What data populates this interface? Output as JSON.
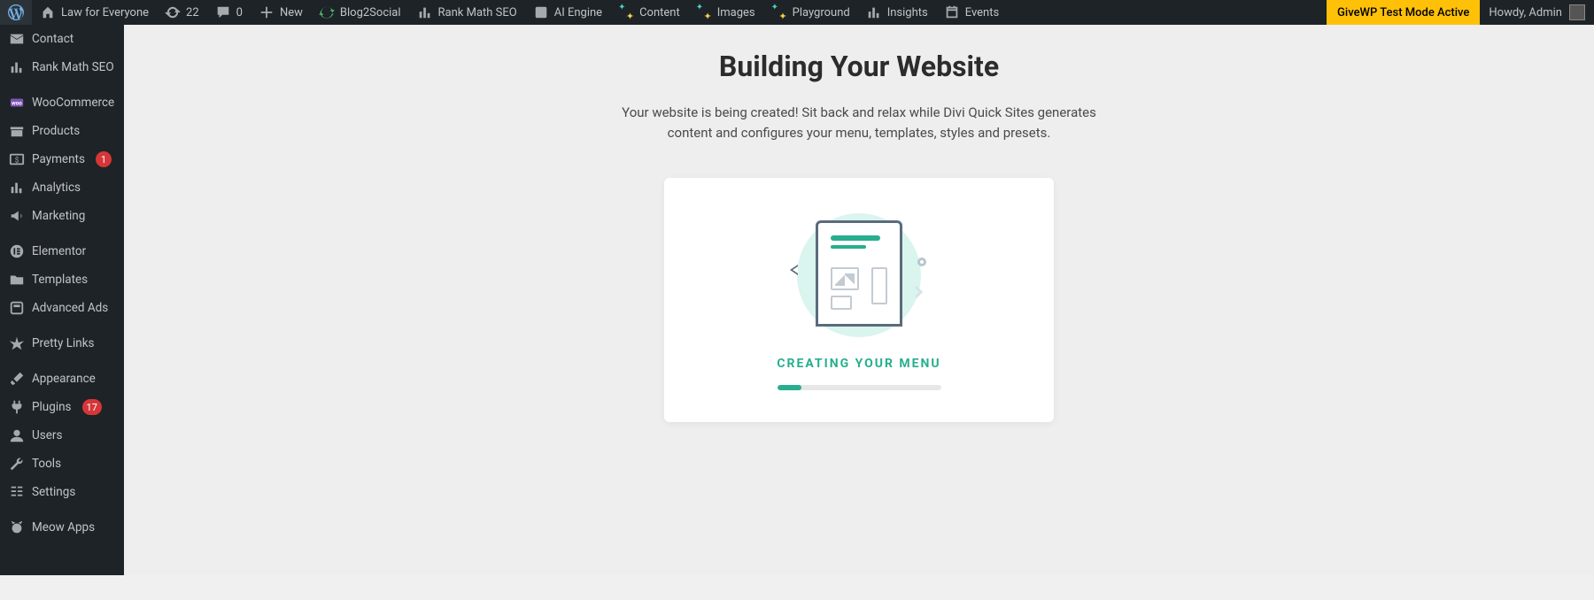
{
  "adminbar": {
    "site_name": "Law for Everyone",
    "updates": "22",
    "comments": "0",
    "new_label": "New",
    "items": [
      "Blog2Social",
      "Rank Math SEO",
      "AI Engine",
      "Content",
      "Images",
      "Playground",
      "Insights",
      "Events"
    ],
    "givewp_notice": "GiveWP Test Mode Active",
    "howdy": "Howdy, Admin"
  },
  "sidebar": {
    "items": [
      {
        "label": "Contact",
        "icon": "mail-icon",
        "badge": null
      },
      {
        "label": "Rank Math SEO",
        "icon": "chart-icon",
        "badge": null
      },
      {
        "spacer": true
      },
      {
        "label": "WooCommerce",
        "icon": "woo-icon",
        "badge": null
      },
      {
        "label": "Products",
        "icon": "archive-icon",
        "badge": null
      },
      {
        "label": "Payments",
        "icon": "payments-icon",
        "badge": "1"
      },
      {
        "label": "Analytics",
        "icon": "analytics-icon",
        "badge": null
      },
      {
        "label": "Marketing",
        "icon": "megaphone-icon",
        "badge": null
      },
      {
        "spacer": true
      },
      {
        "label": "Elementor",
        "icon": "elementor-icon",
        "badge": null
      },
      {
        "label": "Templates",
        "icon": "folder-icon",
        "badge": null
      },
      {
        "label": "Advanced Ads",
        "icon": "ads-icon",
        "badge": null
      },
      {
        "spacer": true
      },
      {
        "label": "Pretty Links",
        "icon": "star-icon",
        "badge": null
      },
      {
        "spacer": true
      },
      {
        "label": "Appearance",
        "icon": "brush-icon",
        "badge": null
      },
      {
        "label": "Plugins",
        "icon": "plug-icon",
        "badge": "17"
      },
      {
        "label": "Users",
        "icon": "user-icon",
        "badge": null
      },
      {
        "label": "Tools",
        "icon": "wrench-icon",
        "badge": null
      },
      {
        "label": "Settings",
        "icon": "settings-icon",
        "badge": null
      },
      {
        "spacer": true
      },
      {
        "label": "Meow Apps",
        "icon": "meow-icon",
        "badge": null
      }
    ]
  },
  "main": {
    "title": "Building Your Website",
    "description": "Your website is being created! Sit back and relax while Divi Quick Sites generates content and configures your menu, templates, styles and presets.",
    "status": "CREATING YOUR MENU",
    "progress_pct": 15
  }
}
